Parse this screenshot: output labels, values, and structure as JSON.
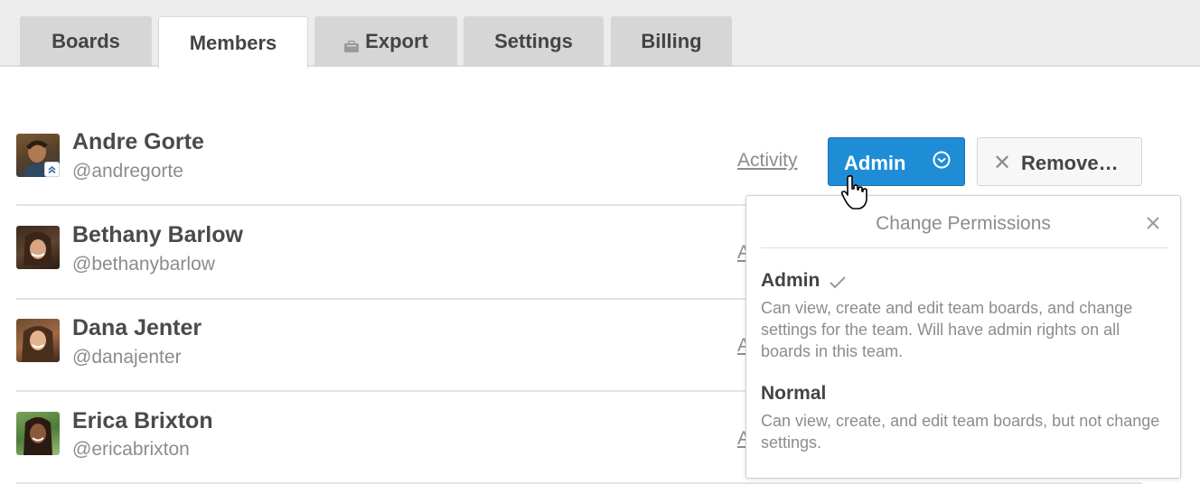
{
  "tabs": [
    {
      "label": "Boards",
      "active": false
    },
    {
      "label": "Members",
      "active": true
    },
    {
      "label": "Export",
      "active": false,
      "icon": "briefcase-icon"
    },
    {
      "label": "Settings",
      "active": false
    },
    {
      "label": "Billing",
      "active": false
    }
  ],
  "members": [
    {
      "name": "Andre Gorte",
      "handle": "@andregorte",
      "activity_label": "Activity",
      "badge": "admin-chevron-icon"
    },
    {
      "name": "Bethany Barlow",
      "handle": "@bethanybarlow",
      "activity_label": "A"
    },
    {
      "name": "Dana Jenter",
      "handle": "@danajenter",
      "activity_label": "A"
    },
    {
      "name": "Erica Brixton",
      "handle": "@ericabrixton",
      "activity_label": "A"
    }
  ],
  "actions": {
    "admin_label": "Admin",
    "remove_label": "Remove…"
  },
  "popover": {
    "title": "Change Permissions",
    "options": [
      {
        "title": "Admin",
        "selected": true,
        "description": "Can view, create and edit team boards, and change settings for the team. Will have admin rights on all boards in this team."
      },
      {
        "title": "Normal",
        "selected": false,
        "description": "Can view, create, and edit team boards, but not change settings."
      }
    ]
  },
  "colors": {
    "primary_button": "#1f8dd6",
    "tab_active": "#ffffff",
    "tab_inactive": "#d6d6d6",
    "muted_text": "#8c8c8c"
  }
}
